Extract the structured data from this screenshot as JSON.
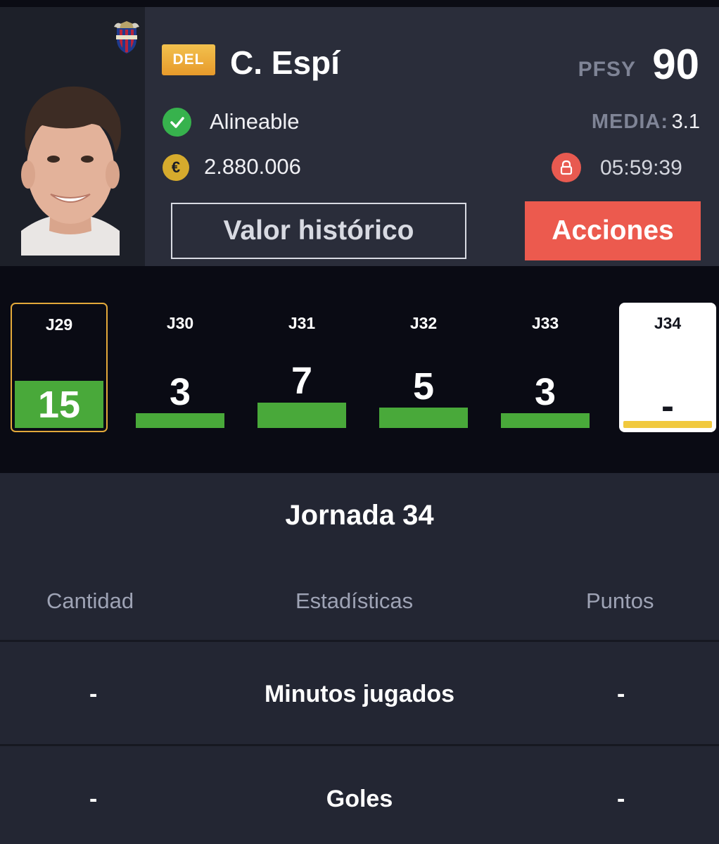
{
  "player": {
    "position": "DEL",
    "name": "C. Espí",
    "pfsy_label": "PFSY",
    "pfsy_value": "90",
    "status": "Alineable",
    "media_label": "MEDIA:",
    "media_value": "3.1",
    "value": "2.880.006",
    "timer": "05:59:39"
  },
  "buttons": {
    "history_label": "Valor histórico",
    "actions_label": "Acciones"
  },
  "colors": {
    "accent_red": "#ec5a4e",
    "bar_green": "#49a93a",
    "selected_border": "#e3a93a",
    "current_bar": "#f1c93e",
    "status_green": "#37b24d",
    "coin_gold": "#d6ab2d"
  },
  "rounds": [
    {
      "label": "J29",
      "points": "15",
      "state": "selected"
    },
    {
      "label": "J30",
      "points": "3",
      "state": "normal"
    },
    {
      "label": "J31",
      "points": "7",
      "state": "normal"
    },
    {
      "label": "J32",
      "points": "5",
      "state": "normal"
    },
    {
      "label": "J33",
      "points": "3",
      "state": "normal"
    },
    {
      "label": "J34",
      "points": "-",
      "state": "current"
    }
  ],
  "stats": {
    "title": "Jornada 34",
    "columns": [
      "Cantidad",
      "Estadísticas",
      "Puntos"
    ],
    "rows": [
      {
        "cantidad": "-",
        "name": "Minutos jugados",
        "puntos": "-"
      },
      {
        "cantidad": "-",
        "name": "Goles",
        "puntos": "-"
      }
    ]
  },
  "icons": {
    "status": "check-icon",
    "value": "euro-coin-icon",
    "timer": "lock-icon",
    "team": "team-crest-icon"
  }
}
